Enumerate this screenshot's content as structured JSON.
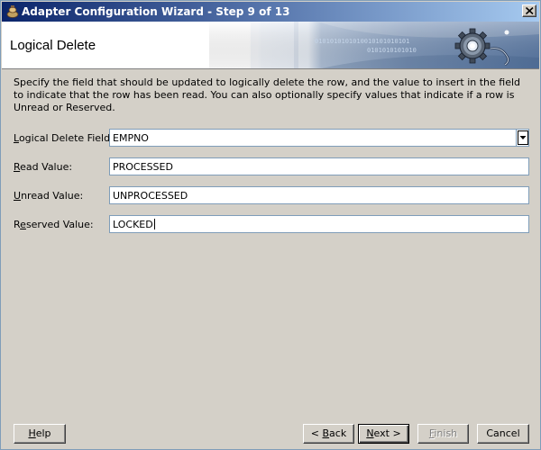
{
  "window": {
    "title": "Adapter Configuration Wizard - Step 9 of 13"
  },
  "banner": {
    "title": "Logical Delete",
    "binary_line1": "0101010101010010101010101",
    "binary_line2": "0101010101010"
  },
  "description": "Specify the field that should be updated to logically delete the row, and the value to insert in the field to indicate that the row has been read.  You can also optionally specify values that indicate if a row is Unread or Reserved.",
  "fields": {
    "logical_delete": {
      "label_mnemonic": "L",
      "label_rest": "ogical Delete Field:",
      "value": "EMPNO"
    },
    "read": {
      "label_mnemonic": "R",
      "label_rest": "ead Value:",
      "value": "PROCESSED"
    },
    "unread": {
      "label_mnemonic": "U",
      "label_rest": "nread Value:",
      "value": "UNPROCESSED"
    },
    "reserved": {
      "label_pre": "R",
      "label_mnemonic": "e",
      "label_rest": "served Value:",
      "value": "LOCKED"
    }
  },
  "buttons": {
    "help": {
      "mnemonic": "H",
      "rest": "elp"
    },
    "back": {
      "pre": "< ",
      "mnemonic": "B",
      "rest": "ack"
    },
    "next": {
      "mnemonic": "N",
      "rest": "ext >"
    },
    "finish": {
      "mnemonic": "F",
      "rest": "inish"
    },
    "cancel": {
      "label": "Cancel"
    }
  }
}
